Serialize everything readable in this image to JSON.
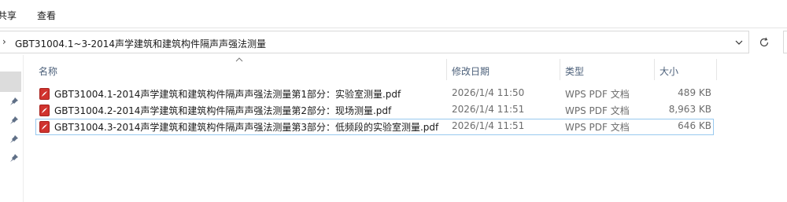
{
  "menu": {
    "share": "共享",
    "view": "查看"
  },
  "address": {
    "path": "GBT31004.1~3-2014声学建筑和建筑构件隔声声强法测量"
  },
  "columns": {
    "name": "名称",
    "date": "修改日期",
    "type": "类型",
    "size": "大小"
  },
  "files": [
    {
      "name": "GBT31004.1-2014声学建筑和建筑构件隔声声强法测量第1部分：实验室测量.pdf",
      "date": "2026/1/4 11:50",
      "type": "WPS PDF 文档",
      "size": "489 KB",
      "selected": false
    },
    {
      "name": "GBT31004.2-2014声学建筑和建筑构件隔声声强法测量第2部分：现场测量.pdf",
      "date": "2026/1/4 11:51",
      "type": "WPS PDF 文档",
      "size": "8,963 KB",
      "selected": false
    },
    {
      "name": "GBT31004.3-2014声学建筑和建筑构件隔声声强法测量第3部分：低频段的实验室测量.pdf",
      "date": "2026/1/4 11:51",
      "type": "WPS PDF 文档",
      "size": "646 KB",
      "selected": true
    }
  ],
  "colors": {
    "pdf_icon": "#d0332e",
    "selection_border": "#99c9ef",
    "header_text": "#4c607a"
  },
  "icons": {
    "file": "pdf-file-icon",
    "pin": "pin-icon",
    "refresh": "refresh-icon",
    "dropdown": "chevron-down-icon",
    "breadcrumb": "chevron-right-icon"
  }
}
